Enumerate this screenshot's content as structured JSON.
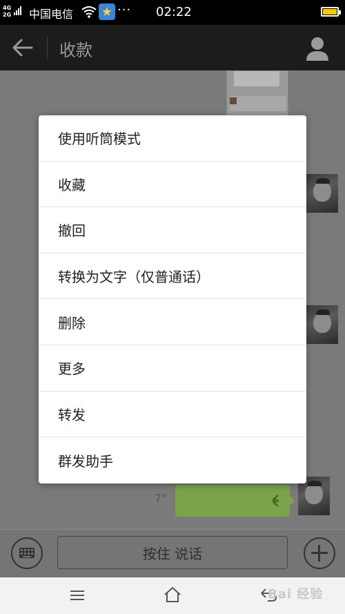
{
  "status_bar": {
    "network_label": "4G 2G",
    "carrier": "中国电信",
    "more_dots": "···",
    "time": "02:22"
  },
  "header": {
    "title": "收款"
  },
  "chat": {
    "voice_duration": "7\""
  },
  "input_bar": {
    "hold_to_talk": "按住 说话"
  },
  "context_menu": {
    "items": [
      {
        "label": "使用听筒模式"
      },
      {
        "label": "收藏"
      },
      {
        "label": "撤回"
      },
      {
        "label": "转换为文字（仅普通话）"
      },
      {
        "label": "删除"
      },
      {
        "label": "更多"
      },
      {
        "label": "转发"
      },
      {
        "label": "群发助手"
      }
    ]
  },
  "watermark": "Bai 经验",
  "colors": {
    "header_bg": "#1c1c1c",
    "voice_bubble": "#7ba34a",
    "battery": "#f5c800"
  },
  "icons": [
    "wifi-icon",
    "star-app-icon",
    "battery-icon",
    "back-arrow-icon",
    "profile-icon",
    "keyboard-icon",
    "plus-icon",
    "voice-wave-icon",
    "menu-nav-icon",
    "home-nav-icon",
    "back-nav-icon"
  ]
}
